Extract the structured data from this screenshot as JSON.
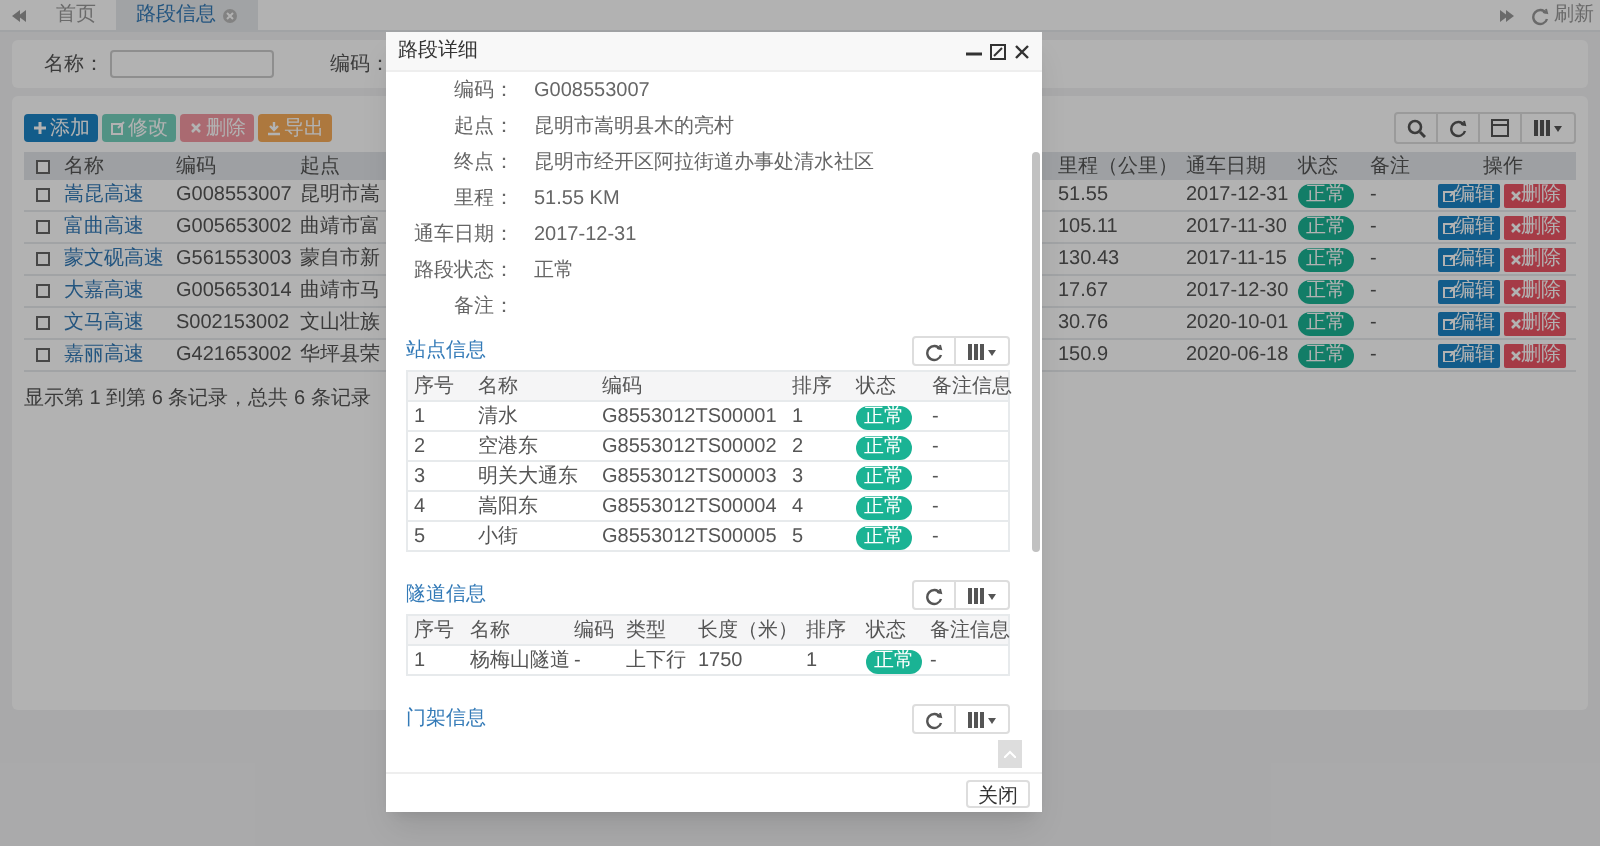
{
  "tabs": [
    {
      "label": "首页",
      "selected": false
    },
    {
      "label": "路段信息",
      "selected": true
    }
  ],
  "refresh": "刷新",
  "search_fields": [
    {
      "label": "名称："
    },
    {
      "label": "编码："
    }
  ],
  "toolbar": [
    {
      "label": "添加",
      "kind": "add",
      "disabled": false
    },
    {
      "label": "修改",
      "kind": "edit",
      "disabled": true
    },
    {
      "label": "删除",
      "kind": "delete",
      "disabled": true
    },
    {
      "label": "导出",
      "kind": "export",
      "disabled": false
    }
  ],
  "table": {
    "columns": [
      "名称",
      "编码",
      "起点",
      "里程（公里）",
      "通车日期",
      "状态",
      "备注",
      "操作"
    ],
    "rows": [
      {
        "checked": false,
        "name": "嵩昆高速",
        "code": "G008553007",
        "start": "昆明市嵩",
        "mileage": "51.55",
        "date": "2017-12-31",
        "status": "正常",
        "note": "-",
        "actions": [
          "编辑",
          "删除"
        ]
      },
      {
        "checked": false,
        "name": "富曲高速",
        "code": "G005653002",
        "start": "曲靖市富",
        "mileage": "105.11",
        "date": "2017-11-30",
        "status": "正常",
        "note": "-",
        "actions": [
          "编辑",
          "删除"
        ]
      },
      {
        "checked": false,
        "name": "蒙文砚高速",
        "code": "G561553003",
        "start": "蒙自市新",
        "mileage": "130.43",
        "date": "2017-11-15",
        "status": "正常",
        "note": "-",
        "actions": [
          "编辑",
          "删除"
        ]
      },
      {
        "checked": false,
        "name": "大嘉高速",
        "code": "G005653014",
        "start": "曲靖市马",
        "mileage": "17.67",
        "date": "2017-12-30",
        "status": "正常",
        "note": "-",
        "actions": [
          "编辑",
          "删除"
        ]
      },
      {
        "checked": false,
        "name": "文马高速",
        "code": "S002153002",
        "start": "文山壮族",
        "mileage": "30.76",
        "date": "2020-10-01",
        "status": "正常",
        "note": "-",
        "actions": [
          "编辑",
          "删除"
        ]
      },
      {
        "checked": false,
        "name": "嘉丽高速",
        "code": "G421653002",
        "start": "华坪县荣",
        "mileage": "150.9",
        "date": "2020-06-18",
        "status": "正常",
        "note": "-",
        "actions": [
          "编辑",
          "删除"
        ]
      }
    ],
    "footer": "显示第 1 到第 6 条记录，总共 6 条记录"
  },
  "modal": {
    "title": "路段详细",
    "fields": [
      {
        "label": "编码：",
        "value": "G008553007"
      },
      {
        "label": "起点：",
        "value": "昆明市嵩明县木的亮村"
      },
      {
        "label": "终点：",
        "value": "昆明市经开区阿拉街道办事处清水社区"
      },
      {
        "label": "里程：",
        "value": "51.55 KM"
      },
      {
        "label": "通车日期：",
        "value": "2017-12-31"
      },
      {
        "label": "路段状态：",
        "value": "正常"
      },
      {
        "label": "备注："
      }
    ],
    "sections": [
      {
        "title": "站点信息",
        "columns": [
          "序号",
          "名称",
          "编码",
          "排序",
          "状态",
          "备注信息"
        ],
        "rows": [
          [
            "1",
            "清水",
            "G8553012TS00001",
            "1",
            "正常",
            "-"
          ],
          [
            "2",
            "空港东",
            "G8553012TS00002",
            "2",
            "正常",
            "-"
          ],
          [
            "3",
            "明关大通东",
            "G8553012TS00003",
            "3",
            "正常",
            "-"
          ],
          [
            "4",
            "嵩阳东",
            "G8553012TS00004",
            "4",
            "正常",
            "-"
          ],
          [
            "5",
            "小街",
            "G8553012TS00005",
            "5",
            "正常",
            "-"
          ]
        ]
      },
      {
        "title": "隧道信息",
        "columns": [
          "序号",
          "名称",
          "编码",
          "类型",
          "长度（米）",
          "排序",
          "状态",
          "备注信息"
        ],
        "rows": [
          [
            "1",
            "杨梅山隧道",
            "-",
            "上下行",
            "1750",
            "1",
            "正常",
            "-"
          ]
        ]
      },
      {
        "title": "门架信息"
      }
    ],
    "close": "关闭"
  }
}
